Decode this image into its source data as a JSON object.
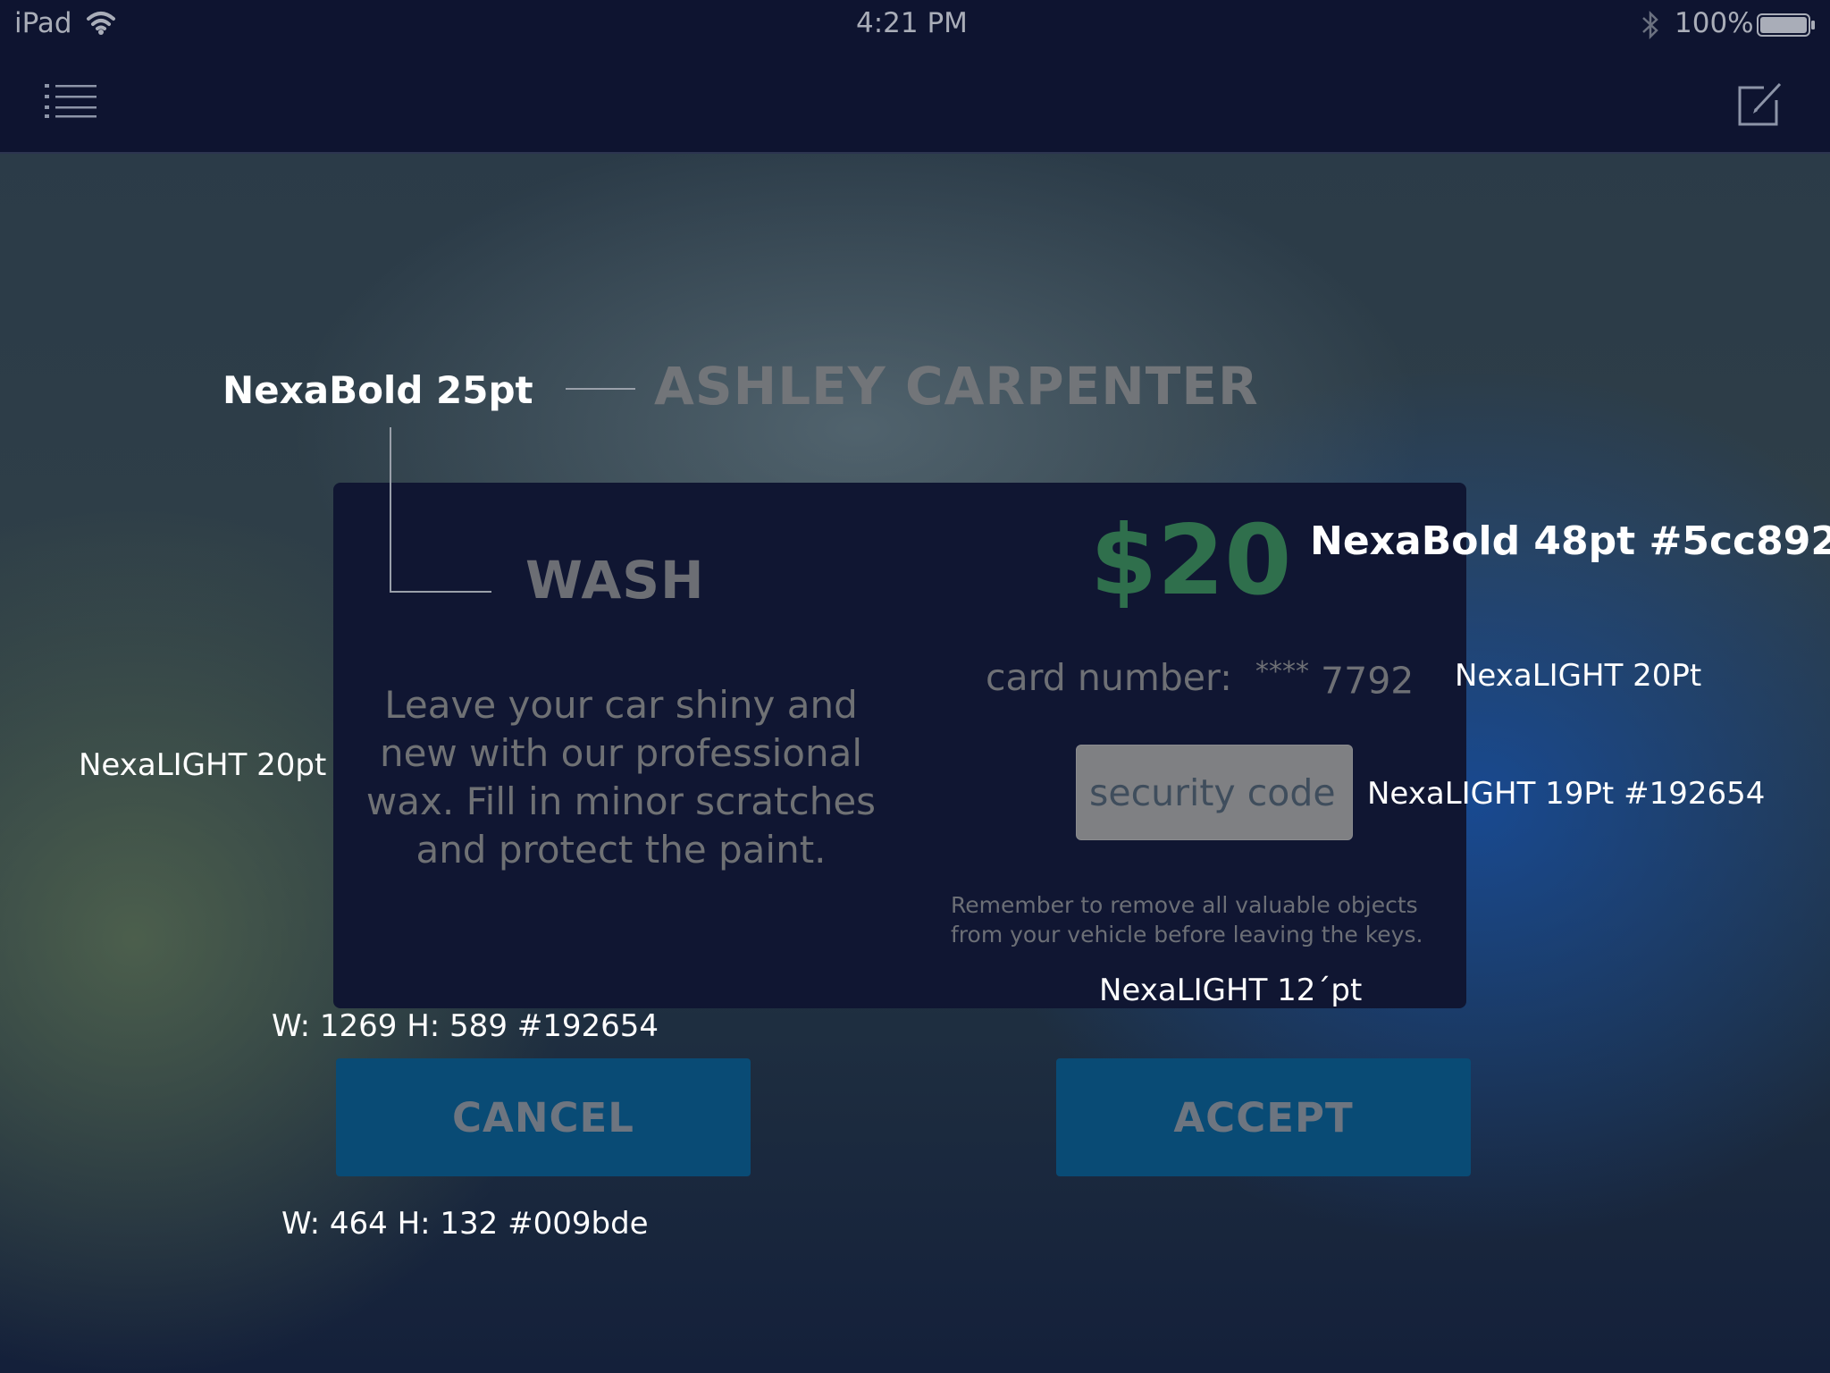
{
  "status_bar": {
    "device": "iPad",
    "time": "4:21 PM",
    "battery": "100%"
  },
  "nav": {
    "menu_icon": "list-menu-icon",
    "compose_icon": "compose-icon"
  },
  "customer": {
    "name": "ASHLEY CARPENTER"
  },
  "service": {
    "name": "WASH",
    "description": "Leave your car shiny and new with our  professional wax. Fill  in minor scratches and protect the paint."
  },
  "payment": {
    "price": "$20",
    "card_label": "card number:",
    "card_mask": "****",
    "card_last4": "7792",
    "security_placeholder": "security code",
    "reminder": "Remember to remove all valuable objects from your vehicle before leaving the keys."
  },
  "buttons": {
    "cancel": "CANCEL",
    "accept": "ACCEPT"
  },
  "annotations": {
    "name_font": "NexaBold 25pt",
    "price_font": "NexaBold 48pt #5cc892",
    "card_font": "NexaLIGHT 20Pt",
    "description_font": "NexaLIGHT 20pt",
    "security_font": "NexaLIGHT 19Pt #192654",
    "reminder_font": "NexaLIGHT 12´pt",
    "dialog_spec": "W: 1269 H: 589 #192654",
    "button_spec": "W: 464 H: 132 #009bde"
  },
  "colors": {
    "bar": "#0e1430",
    "dialog": "#101632",
    "price": "#2f6f4c",
    "button": "#094b75",
    "spec_dialog": "#192654",
    "spec_button": "#009bde",
    "spec_price": "#5cc892"
  }
}
